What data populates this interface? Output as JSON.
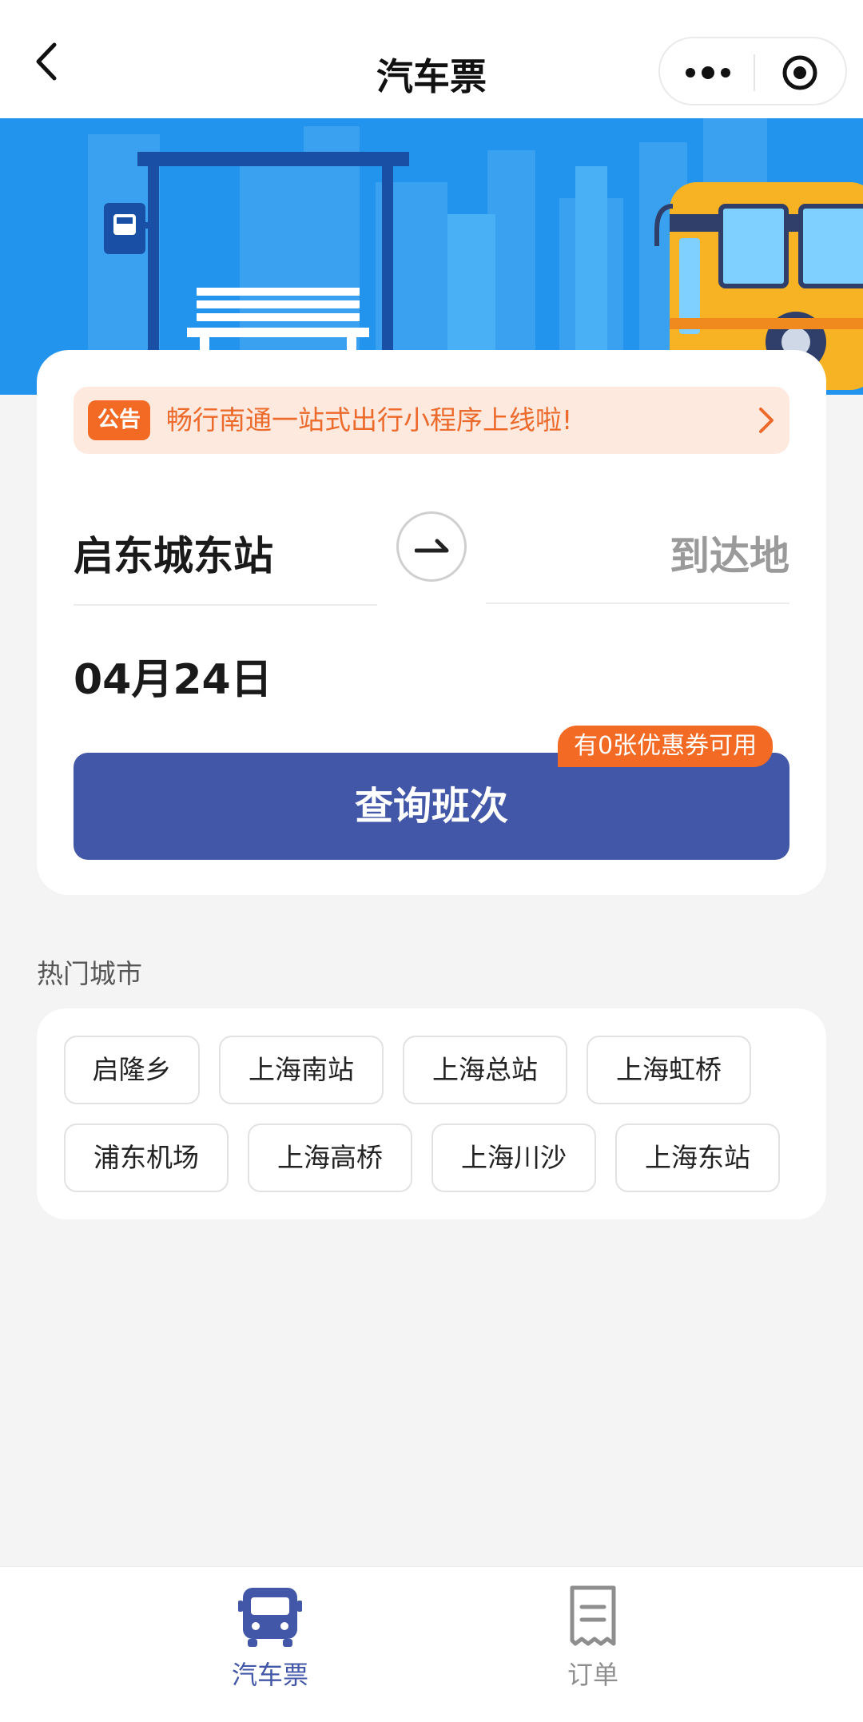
{
  "navbar": {
    "title": "汽车票",
    "back_icon": "chevron-left-icon",
    "more_icon": "more-dots-icon",
    "close_icon": "target-circle-icon"
  },
  "banner": {
    "theme_color": "#2394ee",
    "illustration": "bus-stop-illustration"
  },
  "search": {
    "notice_tag": "公告",
    "notice_text": "畅行南通一站式出行小程序上线啦!",
    "from": "启东城东站",
    "to_placeholder": "到达地",
    "date": "04月24日",
    "query_button": "查询班次",
    "coupon_badge": "有0张优惠券可用",
    "accent_color": "#4357a8",
    "badge_color": "#f26a24"
  },
  "hot_cities": {
    "title": "热门城市",
    "items": [
      "启隆乡",
      "上海南站",
      "上海总站",
      "上海虹桥",
      "浦东机场",
      "上海高桥",
      "上海川沙",
      "上海东站"
    ]
  },
  "tabbar": {
    "items": [
      {
        "label": "汽车票",
        "icon": "bus-icon",
        "active": true
      },
      {
        "label": "订单",
        "icon": "receipt-icon",
        "active": false
      }
    ]
  }
}
